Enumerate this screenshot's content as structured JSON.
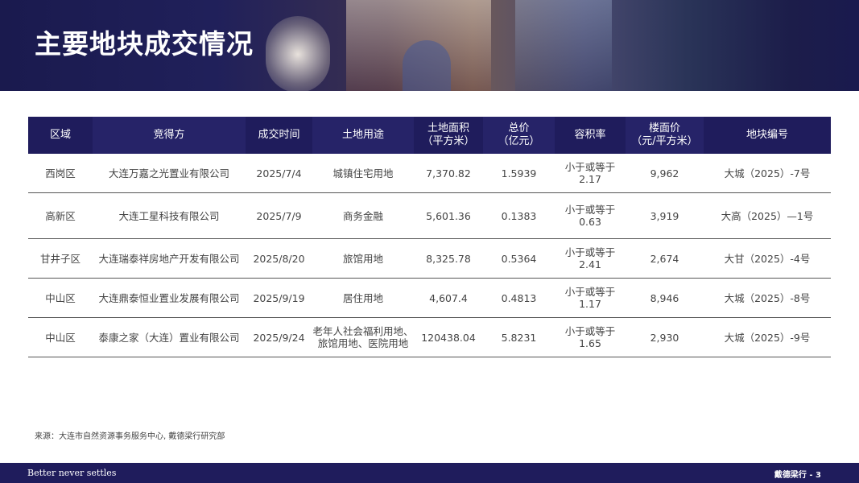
{
  "page": {
    "title": "主要地块成交情况"
  },
  "table": {
    "headers": [
      [
        "区域"
      ],
      [
        "竞得方"
      ],
      [
        "成交时间"
      ],
      [
        "土地用途"
      ],
      [
        "土地面积",
        "（平方米）"
      ],
      [
        "总价",
        "（亿元）"
      ],
      [
        "容积率"
      ],
      [
        "楼面价",
        "（元/平方米）"
      ],
      [
        "地块编号"
      ]
    ],
    "rows": [
      {
        "cells": [
          "西岗区",
          "大连万嘉之光置业有限公司",
          "2025/7/4",
          [
            "城镇住宅用地"
          ],
          "7,370.82",
          "1.5939",
          [
            "小于或等于",
            "2.17"
          ],
          "9,962",
          "大城（2025）-7号"
        ]
      },
      {
        "cells": [
          "高新区",
          "大连工星科技有限公司",
          "2025/7/9",
          [
            "商务金融"
          ],
          "5,601.36",
          "0.1383",
          [
            "小于或等于",
            "0.63"
          ],
          "3,919",
          "大高（2025）—1号"
        ]
      },
      {
        "cells": [
          "甘井子区",
          "大连瑞泰祥房地产开发有限公司",
          "2025/8/20",
          [
            "旅馆用地"
          ],
          "8,325.78",
          "0.5364",
          [
            "小于或等于",
            "2.41"
          ],
          "2,674",
          "大甘（2025）-4号"
        ]
      },
      {
        "cells": [
          "中山区",
          "大连鼎泰恒业置业发展有限公司",
          "2025/9/19",
          [
            "居住用地"
          ],
          "4,607.4",
          "0.4813",
          [
            "小于或等于",
            "1.17"
          ],
          "8,946",
          "大城（2025）-8号"
        ]
      },
      {
        "cells": [
          "中山区",
          "泰康之家（大连）置业有限公司",
          "2025/9/24",
          [
            "老年人社会福利用地、",
            "旅馆用地、医院用地"
          ],
          "120438.04",
          "5.8231",
          [
            "小于或等于",
            "1.65"
          ],
          "2,930",
          "大城（2025）-9号"
        ]
      }
    ]
  },
  "source": "来源：大连市自然资源事务服务中心, 戴德梁行研究部",
  "footer": {
    "tagline": "Better never settles",
    "page_label": "戴德梁行 - 3"
  }
}
